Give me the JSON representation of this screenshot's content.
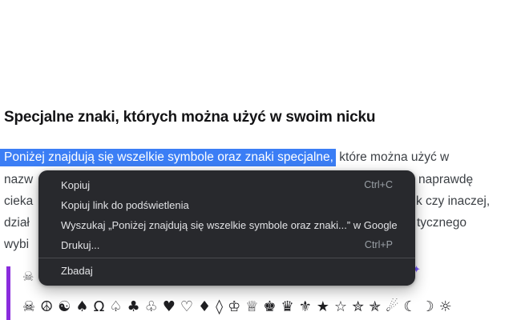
{
  "page": {
    "heading": "Specjalne znaki, których można użyć w swoim nicku",
    "paragraph": {
      "selected": "Poniżej znajdują się wszelkie symbole oraz znaki specjalne,",
      "after_selected": " które można użyć w",
      "line2_left": "nazw",
      "line2_right": "naprawdę",
      "line3_left": "cieka",
      "line3_right": "k czy inaczej,",
      "line4_left": "dział",
      "line4_right": "tycznego",
      "line5_left": "wybi"
    },
    "symbols": {
      "partial_top": "☠",
      "partial_edge": "✦",
      "row": [
        "☠",
        "☮",
        "☯",
        "♠",
        "Ω",
        "♤",
        "♣",
        "♧",
        "♥",
        "♡",
        "♦",
        "◊",
        "♔",
        "♕",
        "♚",
        "♛",
        "⚜",
        "★",
        "☆",
        "✮",
        "✯",
        "☄",
        "☾",
        "☽",
        "☼"
      ]
    }
  },
  "context_menu": {
    "items": [
      {
        "label": "Kopiuj",
        "shortcut": "Ctrl+C"
      },
      {
        "label": "Kopiuj link do podświetlenia",
        "shortcut": ""
      },
      {
        "label": "Wyszukaj „Poniżej znajdują się wszelkie symbole oraz znaki...” w Google",
        "shortcut": ""
      },
      {
        "label": "Drukuj...",
        "shortcut": "Ctrl+P"
      },
      {
        "label": "Zbadaj",
        "shortcut": ""
      }
    ]
  },
  "colors": {
    "selection_bg": "#3b7ef5",
    "menu_bg": "#28292d",
    "quote_bar": "#8a2cdd"
  }
}
